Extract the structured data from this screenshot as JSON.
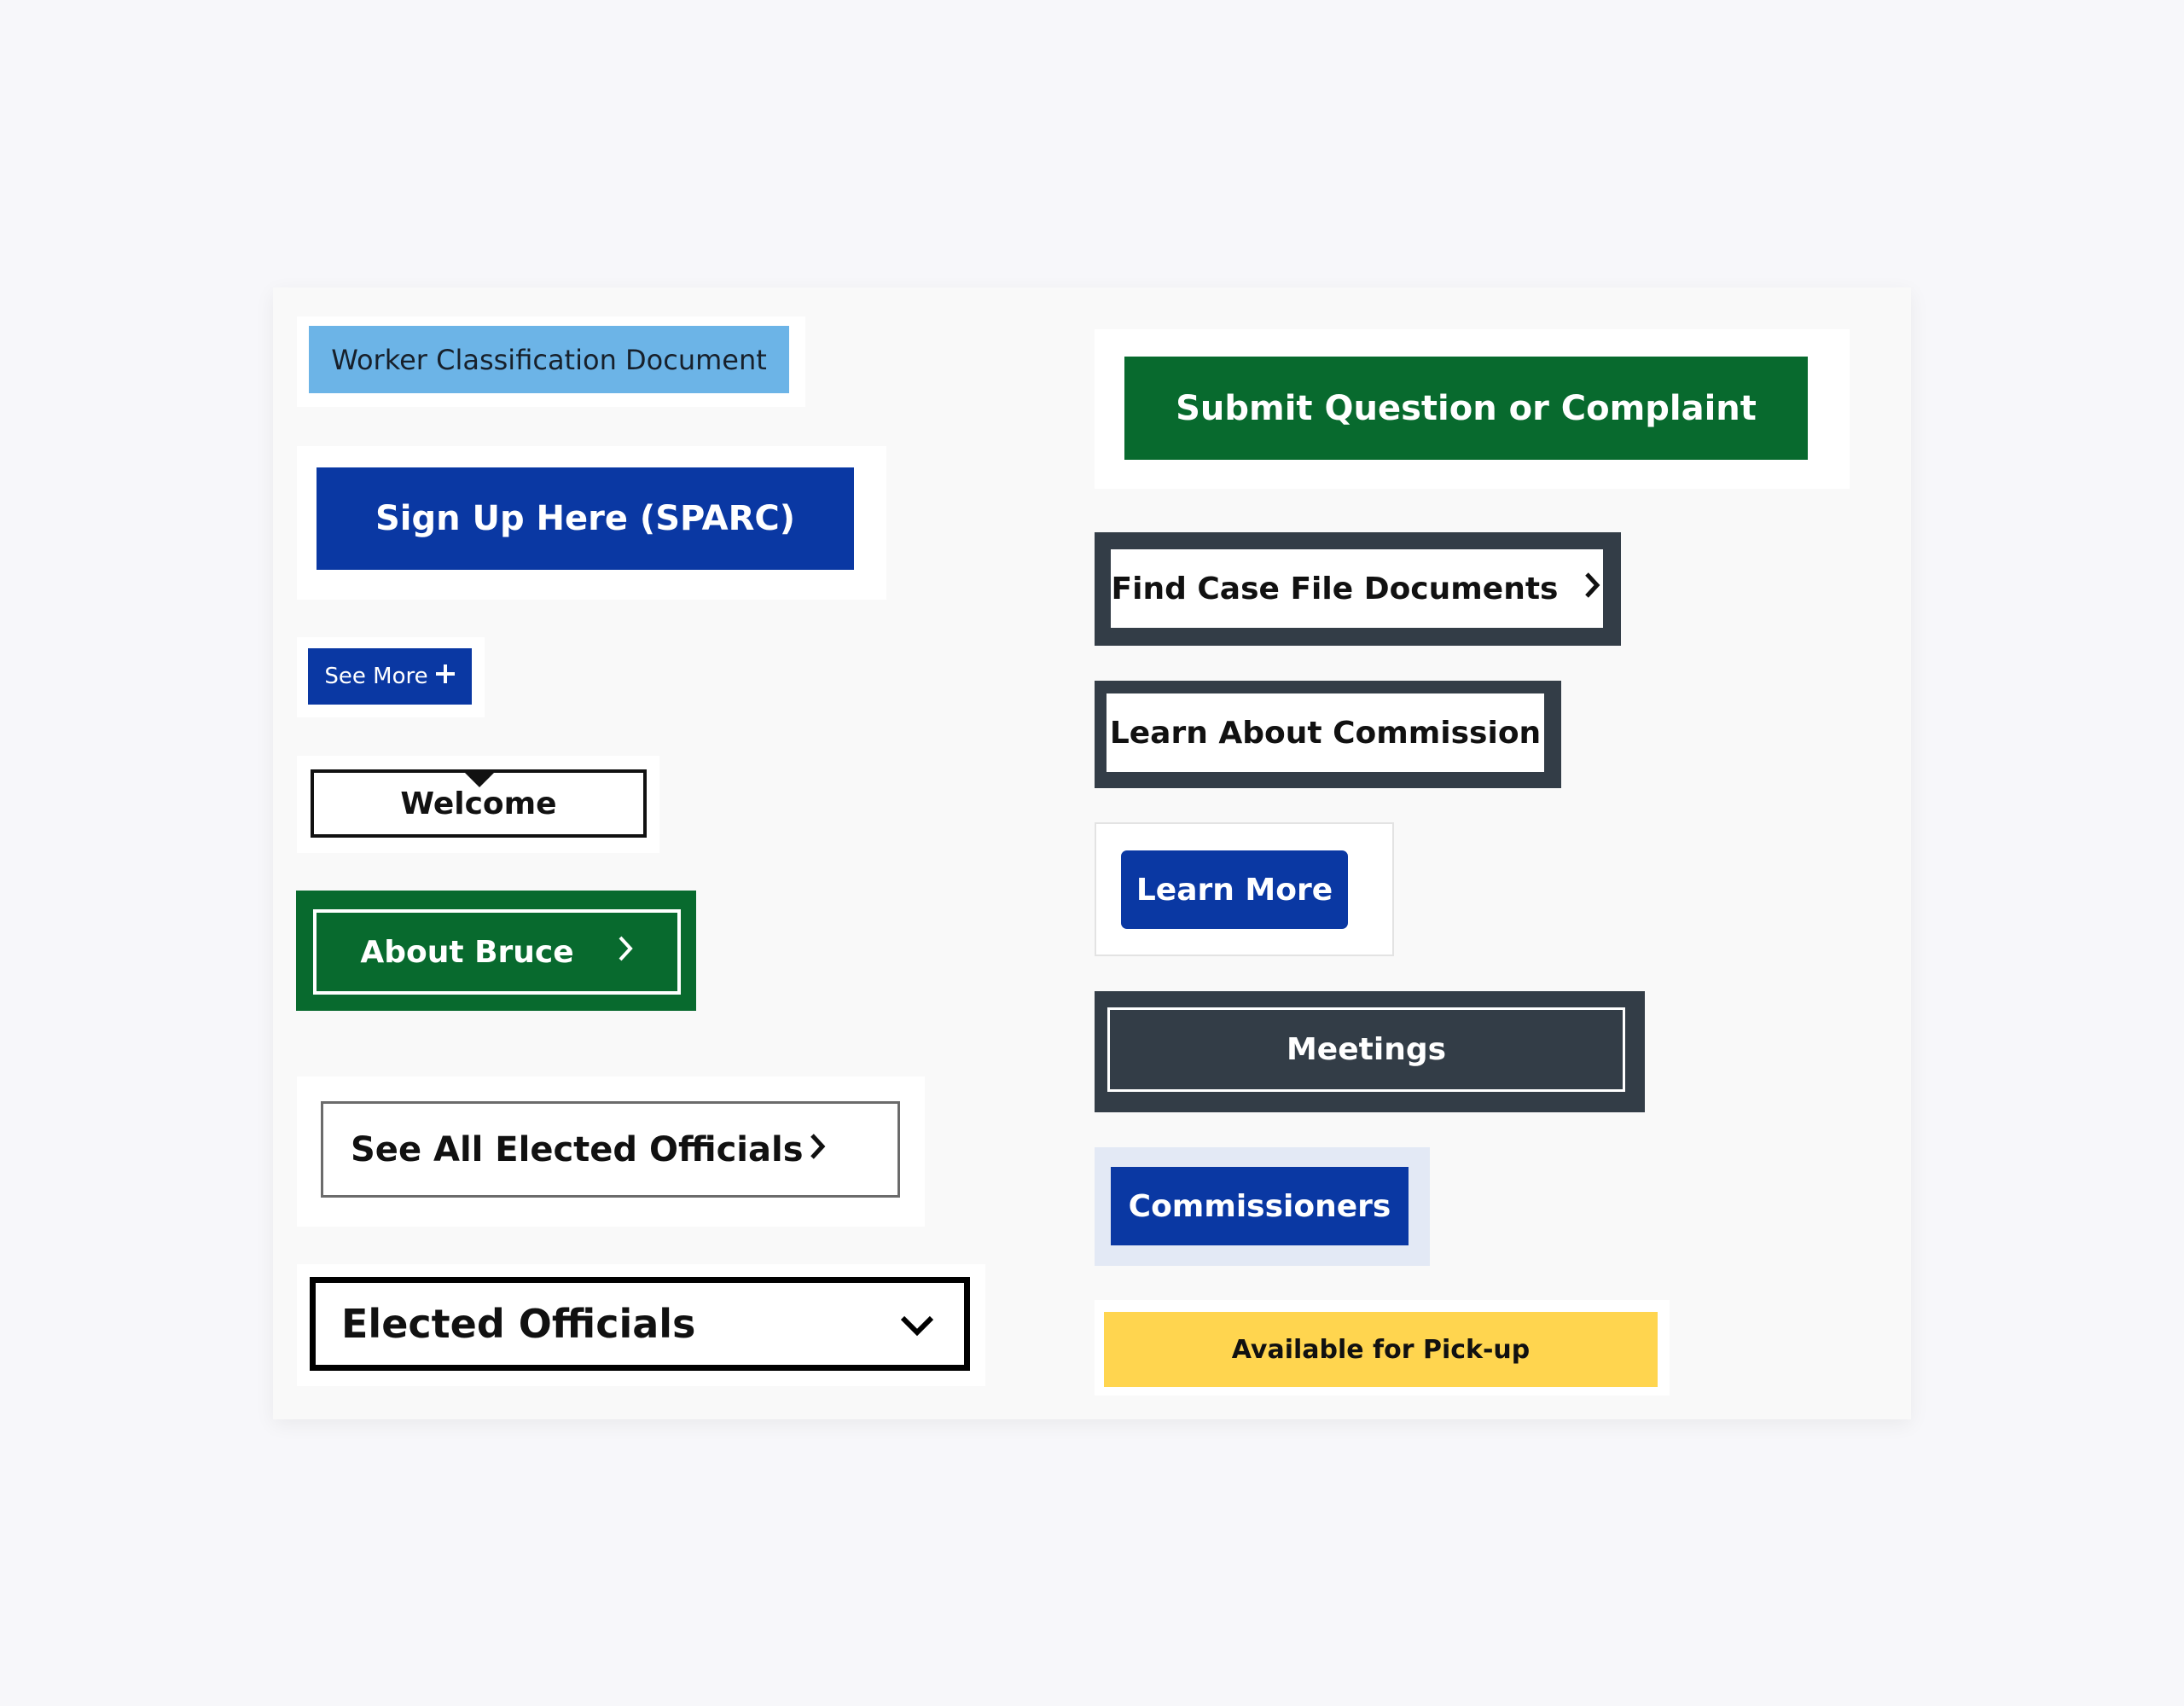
{
  "buttons": {
    "worker_classification": "Worker Classification Document",
    "sign_up_sparc": "Sign Up Here (SPARC)",
    "see_more": "See More",
    "welcome": "Welcome",
    "about_bruce": "About Bruce",
    "see_all_elected_officials": "See All Elected Officials",
    "elected_officials": "Elected Officials",
    "submit_question": "Submit Question or Complaint",
    "find_case_file": "Find Case File Documents",
    "learn_about_commission": "Learn About Commission",
    "learn_more": "Learn More",
    "meetings": "Meetings",
    "commissioners": "Commissioners",
    "available_pickup": "Available for Pick-up"
  },
  "icons": {
    "see_more": "plus-icon",
    "about_bruce": "chevron-right-icon",
    "see_all_elected_officials": "chevron-right-icon",
    "elected_officials": "chevron-down-icon",
    "find_case_file": "chevron-right-icon"
  },
  "colors": {
    "page_background": "#f7f7fa",
    "panel_background": "#f9f9f9",
    "navy_blue": "#0a38a3",
    "light_blue": "#6cb4e7",
    "green": "#086a2e",
    "slate": "#333d47",
    "yellow": "#ffd54f",
    "pale_blue": "#e3e9f5"
  }
}
